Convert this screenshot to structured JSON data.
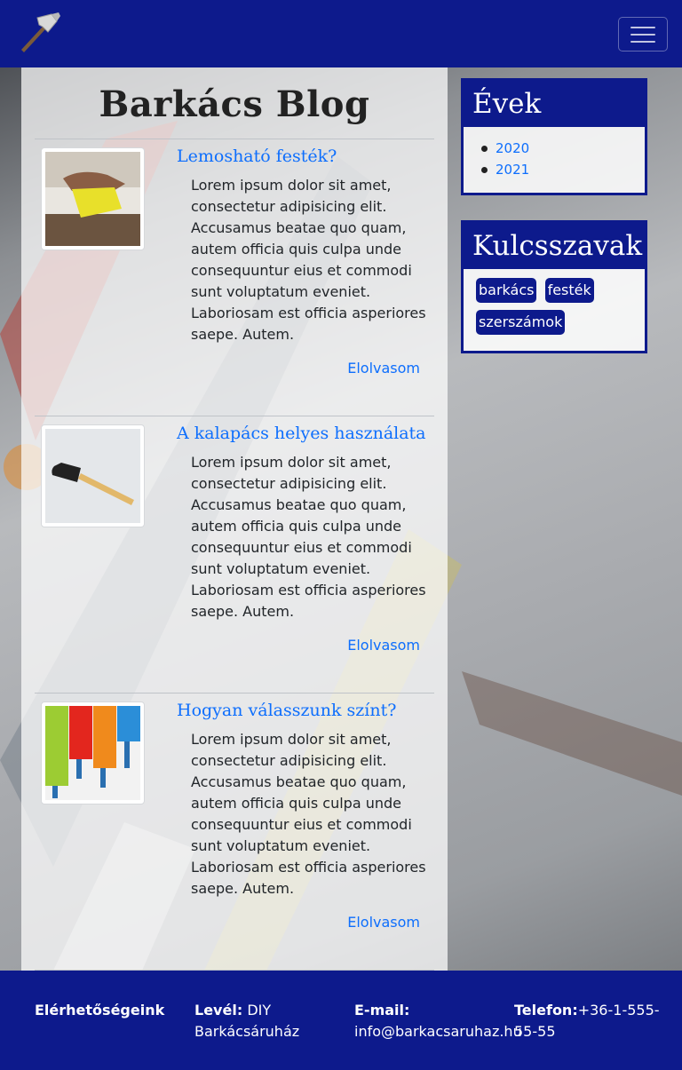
{
  "nav": {
    "logo_icon": "hammer-icon",
    "toggler_icon": "hamburger-menu-icon"
  },
  "blog": {
    "title": "Barkács Blog"
  },
  "posts": [
    {
      "title": "Lemosható festék?",
      "text": "Lorem ipsum dolor sit amet, consectetur adipisicing elit. Accusamus beatae quo quam, autem officia quis culpa unde consequuntur eius et commodi sunt voluptatum eveniet. Laboriosam est officia asperiores saepe. Autem.",
      "link": "Elolvasom",
      "image_icon": "sponge-window-image"
    },
    {
      "title": "A kalapács helyes használata",
      "text": "Lorem ipsum dolor sit amet, consectetur adipisicing elit. Accusamus beatae quo quam, autem officia quis culpa unde consequuntur eius et commodi sunt voluptatum eveniet. Laboriosam est officia asperiores saepe. Autem.",
      "link": "Elolvasom",
      "image_icon": "hammer-image"
    },
    {
      "title": "Hogyan válasszunk színt?",
      "text": "Lorem ipsum dolor sit amet, consectetur adipisicing elit. Accusamus beatae quo quam, autem officia quis culpa unde consequuntur eius et commodi sunt voluptatum eveniet. Laboriosam est officia asperiores saepe. Autem.",
      "link": "Elolvasom",
      "image_icon": "paint-rollers-image"
    }
  ],
  "sidebar": {
    "years_title": "Évek",
    "years": [
      "2020",
      "2021"
    ],
    "keywords_title": "Kulcsszavak",
    "keywords": [
      "barkács",
      "festék",
      "szerszámok"
    ]
  },
  "footer": {
    "contacts_label": "Elérhetőségeink",
    "letter_label": "Levél:",
    "letter_value": "DIY Barkácsáruház",
    "email_label": "E-mail:",
    "email_value": "info@barkacsaruhaz.hu",
    "phone_label": "Telefon:",
    "phone_value": "+36-1-555-55-55"
  },
  "colors": {
    "primary": "#0d1a8c",
    "link": "#0d6efd"
  }
}
